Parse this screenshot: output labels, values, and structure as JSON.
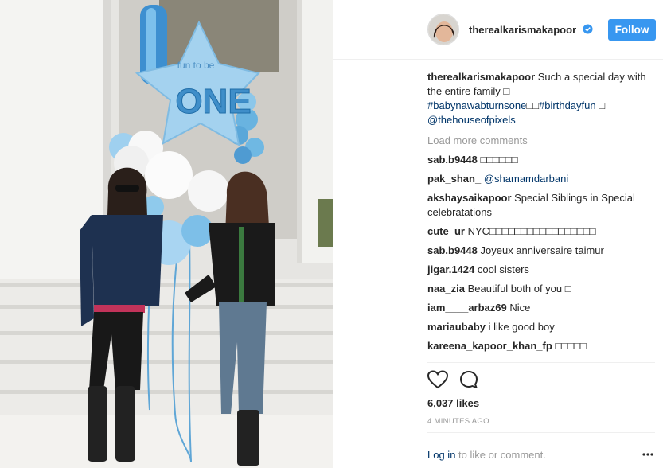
{
  "header": {
    "username": "therealkarismakapoor",
    "follow_label": "Follow"
  },
  "caption": {
    "username": "therealkarismakapoor",
    "text": " Such a special day with the entire family ",
    "emoji": "□",
    "hashtag1": "#babynawabturnsone",
    "hashtag1_suffix": "□□",
    "hashtag2": "#birthdayfun",
    "hashtag2_suffix": " □",
    "mention": "@thehouseofpixels"
  },
  "load_more_label": "Load more comments",
  "comments": [
    {
      "user": "sab.b9448",
      "text": "□□□□□□",
      "mention": ""
    },
    {
      "user": "pak_shan_",
      "text": "",
      "mention": "@shamamdarbani"
    },
    {
      "user": "akshaysaikapoor",
      "text": "Special Siblings in Special celebratations",
      "mention": ""
    },
    {
      "user": "cute_ur",
      "text": "NYC□□□□□□□□□□□□□□□□□",
      "mention": ""
    },
    {
      "user": "sab.b9448",
      "text": "Joyeux anniversaire taimur",
      "mention": ""
    },
    {
      "user": "jigar.1424",
      "text": "cool sisters",
      "mention": ""
    },
    {
      "user": "naa_zia",
      "text": "Beautiful both of you □",
      "mention": ""
    },
    {
      "user": "iam____arbaz69",
      "text": "Nice",
      "mention": ""
    },
    {
      "user": "mariaubaby",
      "text": "i like good boy",
      "mention": ""
    },
    {
      "user": "kareena_kapoor_khan_fp",
      "text": "□□□□□",
      "mention": ""
    }
  ],
  "likes": "6,037 likes",
  "timestamp": "4 MINUTES AGO",
  "login": {
    "link": "Log in",
    "rest": " to like or comment."
  },
  "photo": {
    "balloon_star_text": "fun to be",
    "balloon_one_text": "ONE"
  },
  "icons": {
    "verified": "verified-badge-icon",
    "like": "heart-icon",
    "comment": "comment-bubble-icon",
    "more": "more-options-icon"
  },
  "colors": {
    "follow_button": "#3897f0",
    "link": "#003569",
    "muted": "#999999",
    "balloon_blue": "#7ec3ea"
  }
}
